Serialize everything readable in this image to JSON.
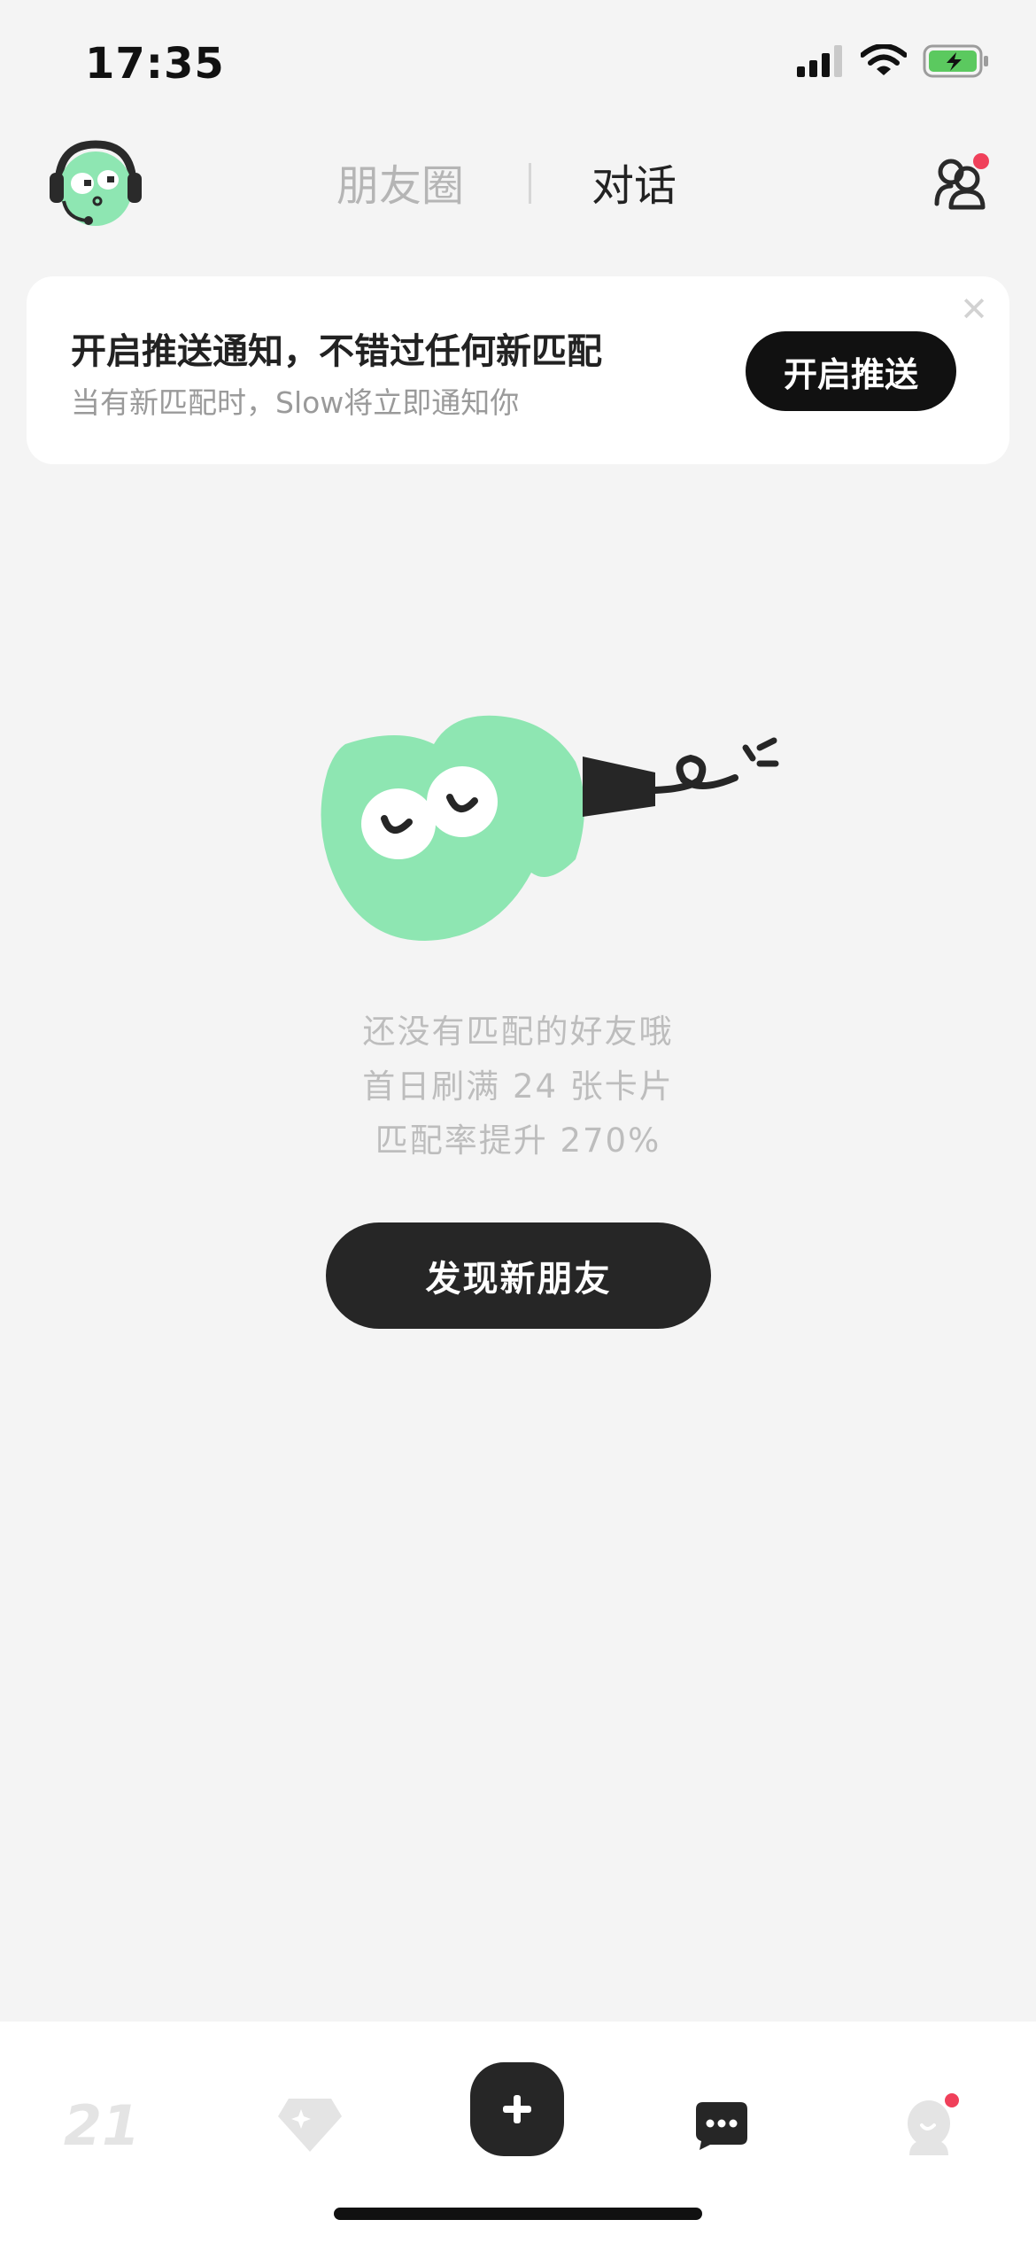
{
  "status_bar": {
    "time": "17:35",
    "icons": [
      "signal-icon",
      "wifi-icon",
      "battery-charging-icon"
    ]
  },
  "header": {
    "avatar_icon": "mascot-headset-avatar",
    "tabs": [
      {
        "label": "朋友圈",
        "active": false
      },
      {
        "label": "对话",
        "active": true
      }
    ],
    "friends_icon": "friends-icon",
    "friends_badge": true
  },
  "push_banner": {
    "title": "开启推送通知，不错过任何新匹配",
    "subtitle": "当有新匹配时，Slow将立即通知你",
    "button_label": "开启推送",
    "close_glyph": "✕"
  },
  "empty_state": {
    "illustration": "green-blob-megaphone-mascot",
    "lines": [
      "还没有匹配的好友哦",
      "首日刷满 24 张卡片",
      "匹配率提升 270%"
    ],
    "button_label": "发现新朋友"
  },
  "bottom_nav": {
    "items": [
      {
        "name": "day-counter",
        "label": "21"
      },
      {
        "name": "gem-icon"
      },
      {
        "name": "add-icon",
        "glyph": "+"
      },
      {
        "name": "chat-bubble-icon"
      },
      {
        "name": "profile-icon",
        "badge": true
      }
    ]
  },
  "colors": {
    "accent_green": "#8ee6b2",
    "badge_red": "#f0405a",
    "dark": "#262626",
    "background": "#f4f4f4"
  }
}
